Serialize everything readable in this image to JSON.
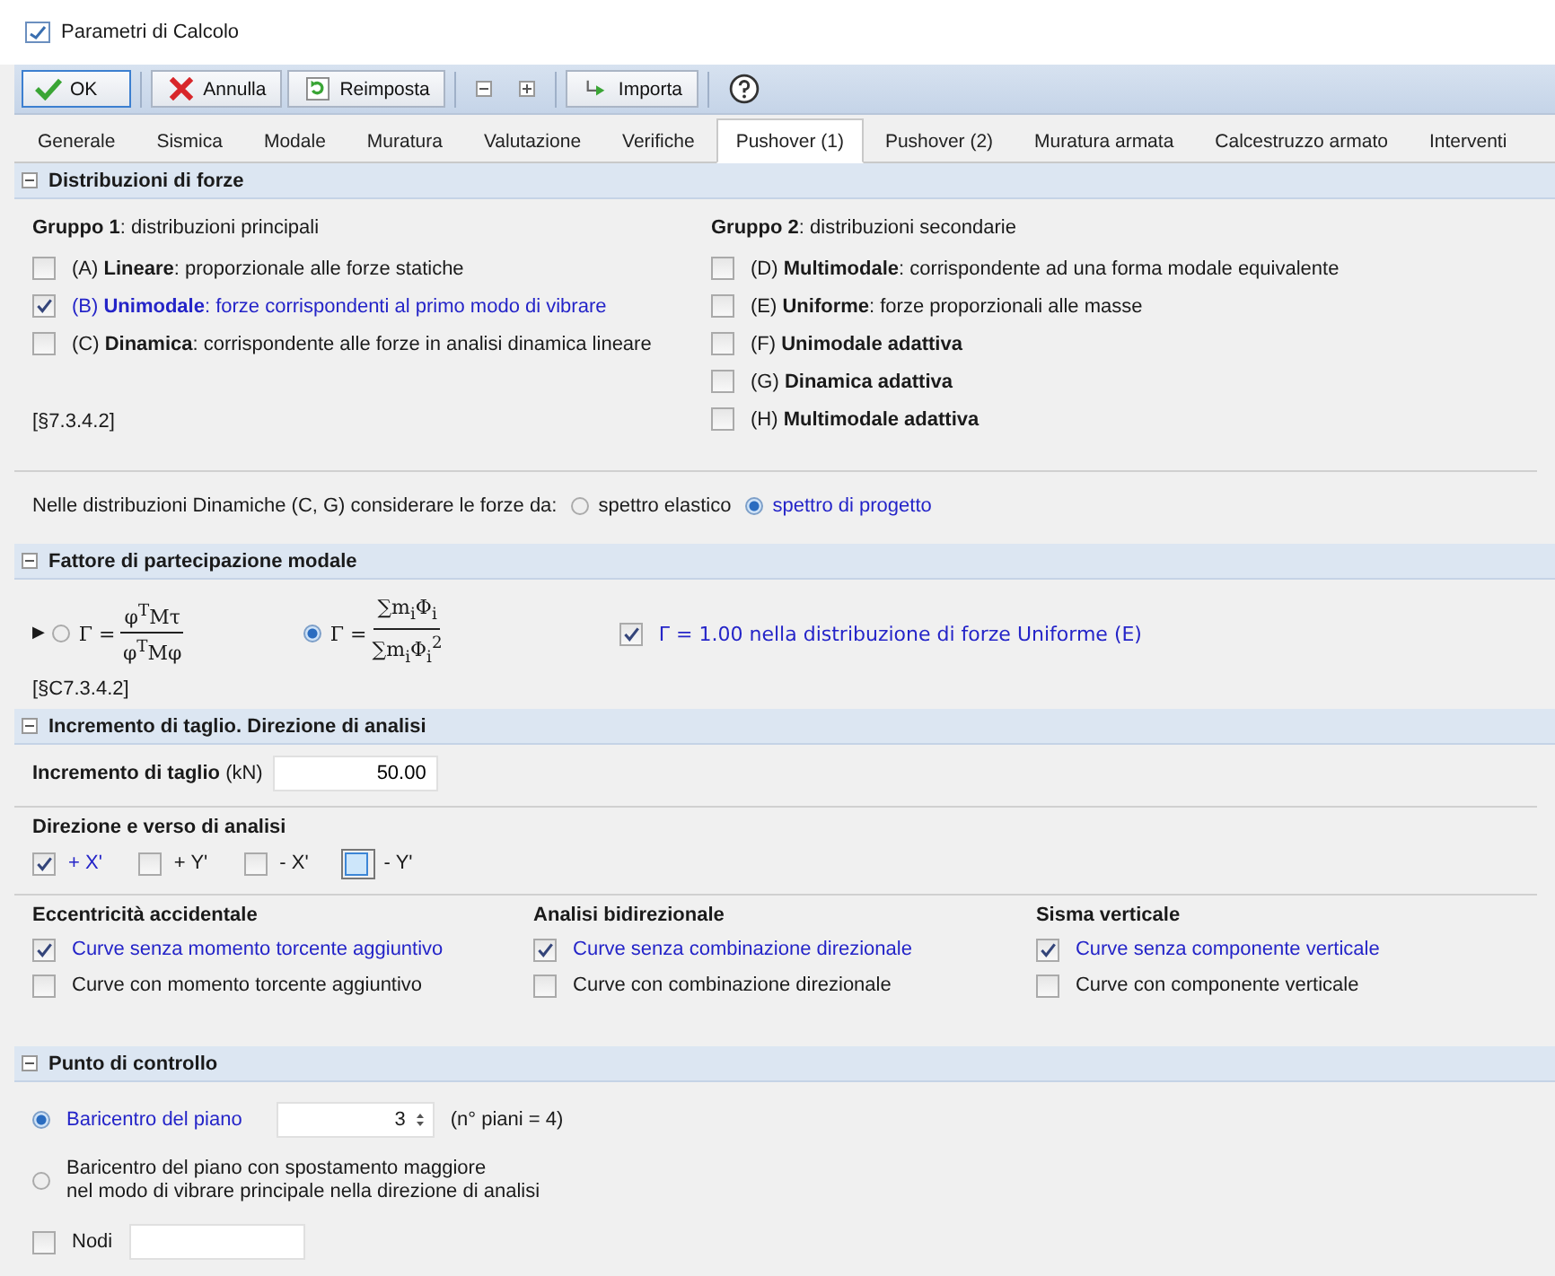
{
  "window": {
    "title": "Parametri di Calcolo"
  },
  "toolbar": [
    {
      "kind": "ok",
      "label": "OK",
      "focused": true
    },
    {
      "kind": "cancel",
      "label": "Annulla",
      "focused": false
    },
    {
      "kind": "reset",
      "label": "Reimposta",
      "focused": false
    },
    {
      "kind": "collapse"
    },
    {
      "kind": "expand"
    },
    {
      "kind": "import",
      "label": "Importa",
      "focused": false
    },
    {
      "kind": "help"
    }
  ],
  "tabs": [
    {
      "label": "Generale",
      "selected": false
    },
    {
      "label": "Sismica",
      "selected": false
    },
    {
      "label": "Modale",
      "selected": false
    },
    {
      "label": "Muratura",
      "selected": false
    },
    {
      "label": "Valutazione",
      "selected": false
    },
    {
      "label": "Verifiche",
      "selected": false
    },
    {
      "label": "Pushover (1)",
      "selected": true
    },
    {
      "label": "Pushover (2)",
      "selected": false
    },
    {
      "label": "Muratura armata",
      "selected": false
    },
    {
      "label": "Calcestruzzo armato",
      "selected": false
    },
    {
      "label": "Interventi",
      "selected": false
    }
  ],
  "distribuzioni": {
    "title": "Distribuzioni di forze",
    "expanded": true,
    "groups": [
      {
        "title": "**Gruppo 1**: distribuzioni principali",
        "items": [
          {
            "label": "(A) **Lineare**: proporzionale alle forze statiche",
            "checked": false
          },
          {
            "label": "(B) **Unimodale**: forze corrispondenti al primo modo di vibrare",
            "checked": true
          },
          {
            "label": "(C) **Dinamica**: corrispondente alle forze in analisi dinamica lineare",
            "checked": false
          }
        ]
      },
      {
        "title": "**Gruppo 2**: distribuzioni secondarie",
        "items": [
          {
            "label": "(D) **Multimodale**: corrispondente ad una forma modale equivalente",
            "checked": false
          },
          {
            "label": "(E) **Uniforme**: forze proporzionali alle masse",
            "checked": false
          },
          {
            "label": "(F) **Unimodale adattiva**",
            "checked": false
          },
          {
            "label": "(G) **Dinamica adattiva**",
            "checked": false
          },
          {
            "label": "(H) **Multimodale adattiva**",
            "checked": false
          }
        ]
      }
    ],
    "reference": "[§7.3.4.2]",
    "spectrum": {
      "label": "Nelle distribuzioni Dinamiche (C, G) considerare le forze da:",
      "options": [
        {
          "label": "spettro elastico",
          "selected": false
        },
        {
          "label": "spettro di progetto",
          "selected": true
        }
      ]
    }
  },
  "fattore": {
    "title": "Fattore di partecipazione modale",
    "expanded": true,
    "marker": "▶",
    "formulas": [
      {
        "selected": false,
        "lhs": "Γ =",
        "numerator": "φ$^{T}$Mτ",
        "denominator": "φ$^{T}$Mφ"
      },
      {
        "selected": true,
        "lhs": "Γ =",
        "numerator": "∑m$_{i}$Φ$_{i}$",
        "denominator": "∑m$_{i}$Φ$_{i}$$^{2}$"
      }
    ],
    "uniform": {
      "label": "Γ = 1.00 nella distribuzione di forze Uniforme (E)",
      "checked": true
    },
    "reference": "[§C7.3.4.2]"
  },
  "incremento": {
    "title": "Incremento di taglio. Direzione di analisi",
    "expanded": true,
    "shear": {
      "label": "**Incremento di taglio** (kN)",
      "value": "50.00"
    },
    "direction": {
      "title": "Direzione e verso di analisi",
      "items": [
        {
          "label": "+ X'",
          "checked": true,
          "focused": false
        },
        {
          "label": "+ Y'",
          "checked": false,
          "focused": false
        },
        {
          "label": "- X'",
          "checked": false,
          "focused": false
        },
        {
          "label": "- Y'",
          "checked": false,
          "focused": true
        }
      ]
    },
    "columns": [
      {
        "title": "Eccentricità accidentale",
        "items": [
          {
            "label": "Curve senza momento torcente aggiuntivo",
            "checked": true
          },
          {
            "label": "Curve con momento torcente aggiuntivo",
            "checked": false
          }
        ]
      },
      {
        "title": "Analisi bidirezionale",
        "items": [
          {
            "label": "Curve senza combinazione direzionale",
            "checked": true
          },
          {
            "label": "Curve con combinazione direzionale",
            "checked": false
          }
        ]
      },
      {
        "title": "Sisma verticale",
        "items": [
          {
            "label": "Curve senza componente verticale",
            "checked": true
          },
          {
            "label": "Curve con componente verticale",
            "checked": false
          }
        ]
      }
    ]
  },
  "punto": {
    "title": "Punto di controllo",
    "expanded": true,
    "options": [
      {
        "kind": "floor",
        "label": "Baricentro del piano",
        "selected": true,
        "value": "3",
        "note": "(n° piani = 4)"
      },
      {
        "kind": "text",
        "label": "Baricentro del piano con spostamento maggiore\nnel modo di vibrare principale nella direzione di analisi",
        "selected": false
      }
    ],
    "nodes": {
      "label": "Nodi",
      "checked": false
    }
  }
}
